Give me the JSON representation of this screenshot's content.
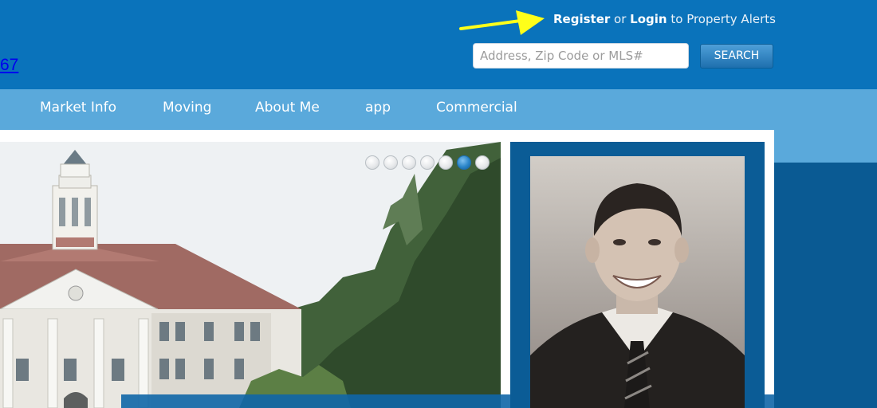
{
  "header": {
    "phone_fragment": "67",
    "account": {
      "register": "Register",
      "or": " or ",
      "login": "Login",
      "suffix": " to Property Alerts"
    },
    "search": {
      "placeholder": "Address, Zip Code or MLS#",
      "value": "",
      "button_label": "SEARCH"
    }
  },
  "nav": {
    "items": [
      {
        "label": "Market Info"
      },
      {
        "label": "Moving"
      },
      {
        "label": "About Me"
      },
      {
        "label": "app"
      },
      {
        "label": "Commercial"
      }
    ]
  },
  "slider": {
    "dot_count": 7,
    "active_index": 5
  },
  "annotation": {
    "arrow_color": "#ffff1a",
    "icon": "arrow-right-icon"
  },
  "colors": {
    "header_blue": "#0a73bb",
    "nav_blue": "#5aa9db",
    "frame_blue": "#0b5c96"
  }
}
